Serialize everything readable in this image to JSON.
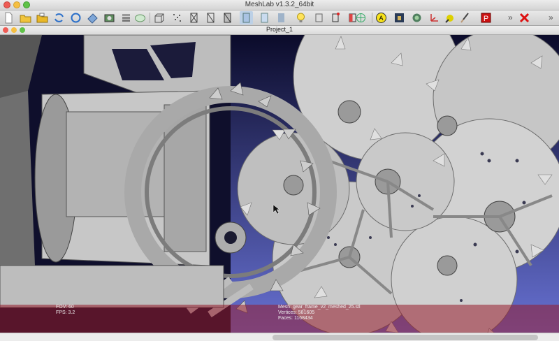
{
  "window": {
    "title": "MeshLab v1.3.2_64bit"
  },
  "document": {
    "title": "Project_1"
  },
  "toolbar": {
    "buttons": [
      "new-file-icon",
      "open-folder-icon",
      "open-project-icon",
      "save-folder-icon",
      "reload-icon",
      "export-icon",
      "snapshot-icon",
      "layers-icon",
      "globe-icon",
      "bbox-icon",
      "points-icon",
      "wireframe-icon",
      "hidden-lines-icon",
      "flat-lines-icon",
      "flat-shading-icon",
      "smooth-shading-icon",
      "texture-icon",
      "light-icon",
      "double-light-icon",
      "cull-icon",
      "vertex-select-icon",
      "face-select-icon",
      "axis-icon",
      "annotate-icon",
      "image-icon",
      "filter-icon",
      "coordinate-axes-icon",
      "paint-icon",
      "pickpoints-icon",
      "close-red-icon"
    ],
    "more_label": "»"
  },
  "info": {
    "fov": "FOV: 60",
    "fps": "FPS:     3.2",
    "mesh": "Mesh: gear_frame_v2_meshed_25.stl",
    "vertices": "Vertices: 581605",
    "faces": "Faces: 1168434"
  },
  "colors": {
    "bg_top": "#0b0b2a",
    "bg_bottom": "#6a74d8",
    "gear": "#bdbdbd",
    "info_bar": "#961c2c"
  }
}
